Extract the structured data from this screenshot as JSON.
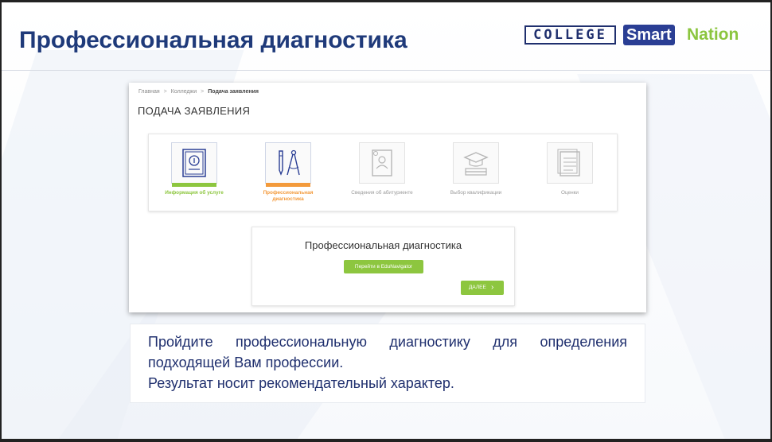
{
  "slide": {
    "title": "Профессиональная диагностика",
    "logo_college": "COLLEGE",
    "logo_smart": "Smart",
    "logo_nation": "Nation"
  },
  "screenshot": {
    "breadcrumb": [
      "Главная",
      "Колледжи",
      "Подача заявления"
    ],
    "page_heading": "ПОДАЧА ЗАЯВЛЕНИЯ",
    "steps": [
      {
        "label": "Информация об услуге",
        "icon": "passport-icon",
        "state": "completed",
        "color": "#8dc63f"
      },
      {
        "label": "Профессиональная диагностика",
        "icon": "drawing-tools-icon",
        "state": "active",
        "color": "#f39a3b"
      },
      {
        "label": "Сведения об абитуриенте",
        "icon": "profile-document-icon",
        "state": "inactive",
        "color": "#9a9a9a"
      },
      {
        "label": "Выбор квалификации",
        "icon": "graduation-cap-books-icon",
        "state": "inactive",
        "color": "#9a9a9a"
      },
      {
        "label": "Оценки",
        "icon": "grades-document-icon",
        "state": "inactive",
        "color": "#9a9a9a"
      }
    ],
    "diagnostics_title": "Профессиональная диагностика",
    "edunavigator_button": "Перейти в EduNavigator",
    "next_button": "ДАЛЕЕ"
  },
  "caption": {
    "line1": "Пройдите профессиональную диагностику для определения подходящей Вам профессии.",
    "line2": "Результат носит рекомендательный характер."
  },
  "colors": {
    "title": "#1f3a7a",
    "accent_green": "#8dc63f",
    "accent_orange": "#f39a3b",
    "brand_blue": "#2a3e94"
  }
}
